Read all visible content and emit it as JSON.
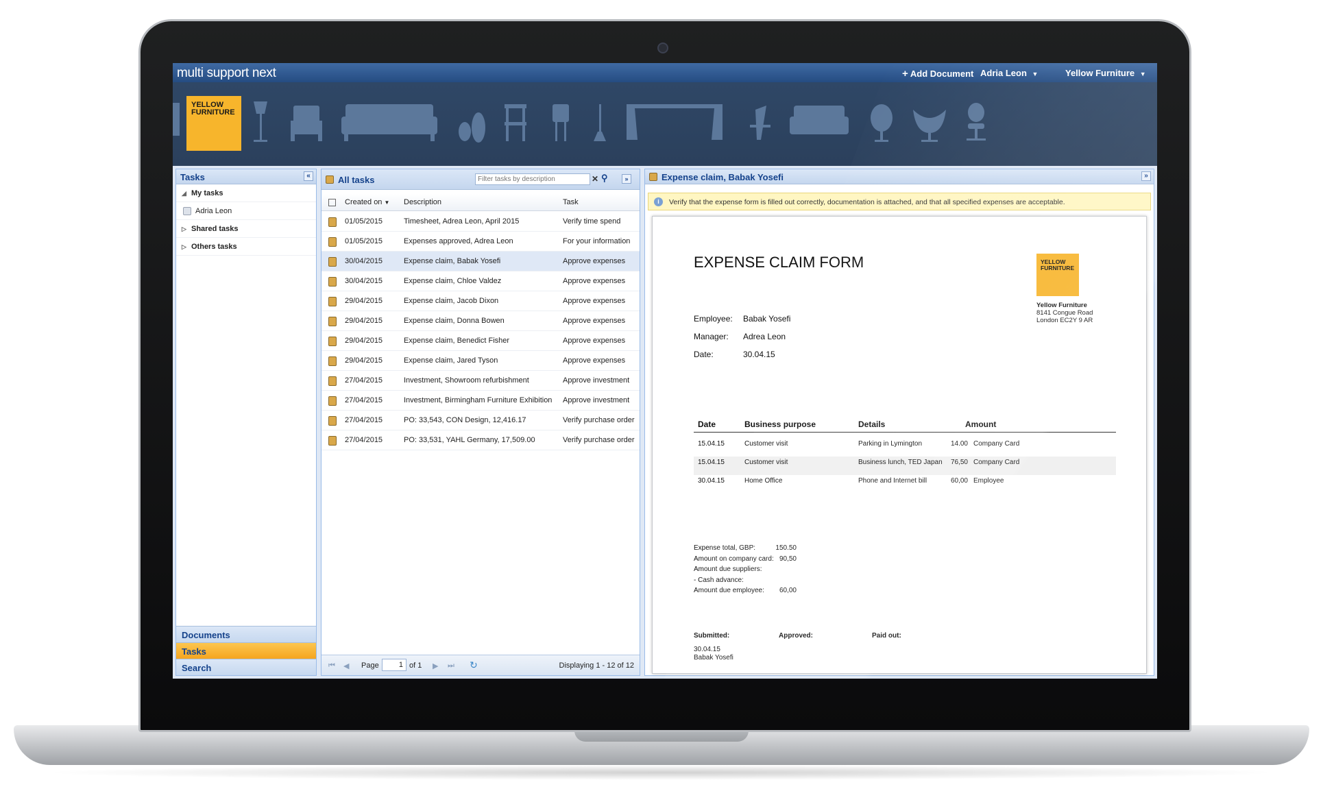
{
  "app": {
    "logo": "multi support next"
  },
  "topbar": {
    "add_document": "Add Document",
    "user": "Adria Leon",
    "company": "Yellow Furniture"
  },
  "banner": {
    "brand_line1": "YELLOW",
    "brand_line2": "FURNITURE"
  },
  "left_panel": {
    "title": "Tasks",
    "tree": [
      {
        "label": "My tasks",
        "expanded": true
      },
      {
        "label": "Adria Leon",
        "child": true
      },
      {
        "label": "Shared tasks",
        "expanded": false
      },
      {
        "label": "Others tasks",
        "expanded": false
      }
    ],
    "accordion": [
      {
        "label": "Documents",
        "active": false
      },
      {
        "label": "Tasks",
        "active": true
      },
      {
        "label": "Search",
        "active": false
      }
    ]
  },
  "task_list": {
    "title": "All tasks",
    "filter_placeholder": "Filter tasks by description",
    "columns": {
      "created": "Created on",
      "description": "Description",
      "task": "Task"
    },
    "rows": [
      {
        "date": "01/05/2015",
        "description": "Timesheet, Adrea Leon, April 2015",
        "task": "Verify time spend"
      },
      {
        "date": "01/05/2015",
        "description": "Expenses approved, Adrea Leon",
        "task": "For your information"
      },
      {
        "date": "30/04/2015",
        "description": "Expense claim, Babak Yosefi",
        "task": "Approve expenses",
        "selected": true
      },
      {
        "date": "30/04/2015",
        "description": "Expense claim, Chloe Valdez",
        "task": "Approve expenses"
      },
      {
        "date": "29/04/2015",
        "description": "Expense claim, Jacob Dixon",
        "task": "Approve expenses"
      },
      {
        "date": "29/04/2015",
        "description": "Expense claim, Donna Bowen",
        "task": "Approve expenses"
      },
      {
        "date": "29/04/2015",
        "description": "Expense claim, Benedict Fisher",
        "task": "Approve expenses"
      },
      {
        "date": "29/04/2015",
        "description": "Expense claim, Jared Tyson",
        "task": "Approve expenses"
      },
      {
        "date": "27/04/2015",
        "description": "Investment, Showroom refurbishment",
        "task": "Approve investment"
      },
      {
        "date": "27/04/2015",
        "description": "Investment, Birmingham Furniture Exhibition",
        "task": "Approve investment"
      },
      {
        "date": "27/04/2015",
        "description": "PO: 33,543, CON Design, 12,416.17",
        "task": "Verify purchase order"
      },
      {
        "date": "27/04/2015",
        "description": "PO: 33,531, YAHL Germany, 17,509.00",
        "task": "Verify purchase order"
      }
    ],
    "pager": {
      "page_label": "Page",
      "page_value": "1",
      "of_label": "of 1",
      "displaying": "Displaying 1 - 12 of 12"
    }
  },
  "detail": {
    "title": "Expense claim, Babak Yosefi",
    "notice": "Verify that the expense form is filled out correctly, documentation is attached, and that all specified expenses are acceptable.",
    "form": {
      "heading": "EXPENSE CLAIM FORM",
      "logo_line1": "YELLOW",
      "logo_line2": "FURNITURE",
      "company_name": "Yellow Furniture",
      "address1": "8141 Congue Road",
      "address2": "London EC2Y 9 AR",
      "employee_label": "Employee:",
      "employee_value": "Babak Yosefi",
      "manager_label": "Manager:",
      "manager_value": "Adrea Leon",
      "date_label": "Date:",
      "date_value": "30.04.15",
      "table_headers": {
        "date": "Date",
        "purpose": "Business purpose",
        "details": "Details",
        "amount": "Amount"
      },
      "expenses": [
        {
          "date": "15.04.15",
          "purpose": "Customer visit",
          "details": "Parking in Lymington",
          "amount": "14.00",
          "paid_by": "Company Card"
        },
        {
          "date": "15.04.15",
          "purpose": "Customer visit",
          "details": "Business lunch, TED Japan",
          "amount": "76,50",
          "paid_by": "Company Card"
        },
        {
          "date": "30.04.15",
          "purpose": "Home Office",
          "details": "Phone and Internet bill",
          "amount": "60,00",
          "paid_by": "Employee"
        }
      ],
      "totals": [
        {
          "label": "Expense total, GBP:",
          "value": "150.50"
        },
        {
          "label": "Amount on company card:",
          "value": "90,50"
        },
        {
          "label": "Amount due suppliers:",
          "value": ""
        },
        {
          "label": "- Cash advance:",
          "value": ""
        },
        {
          "label": "Amount due employee:",
          "value": "60,00"
        }
      ],
      "submitted_label": "Submitted:",
      "approved_label": "Approved:",
      "paid_out_label": "Paid out:",
      "submitted_date": "30.04.15",
      "submitted_by": "Babak Yosefi"
    }
  }
}
